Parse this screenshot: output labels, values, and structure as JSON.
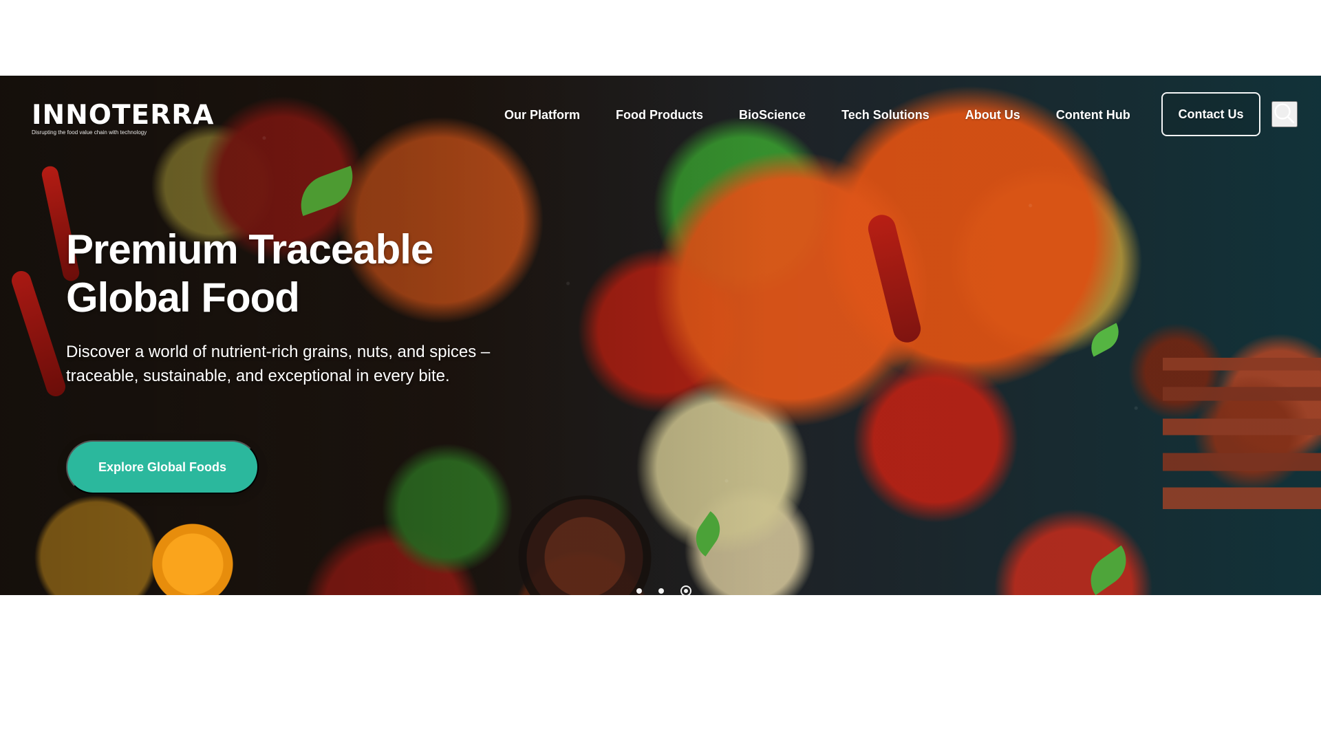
{
  "brand": {
    "name": "INNOTERRA",
    "tagline": "Disrupting the food value chain with technology"
  },
  "nav": {
    "items": [
      {
        "label": "Our Platform"
      },
      {
        "label": "Food Products"
      },
      {
        "label": "BioScience"
      },
      {
        "label": "Tech Solutions"
      },
      {
        "label": "About Us"
      },
      {
        "label": "Content Hub"
      }
    ],
    "contact_label": "Contact Us",
    "search_icon": "search-icon"
  },
  "hero": {
    "title": "Premium Traceable Global Food",
    "subtitle": "Discover a world of nutrient-rich grains, nuts, and spices – traceable, sustainable, and exceptional in every bite.",
    "cta_label": "Explore Global Foods",
    "carousel": {
      "dots": 3,
      "active_index": 3
    }
  },
  "colors": {
    "accent": "#2bb89d",
    "text": "#ffffff",
    "background": "#ffffff"
  }
}
